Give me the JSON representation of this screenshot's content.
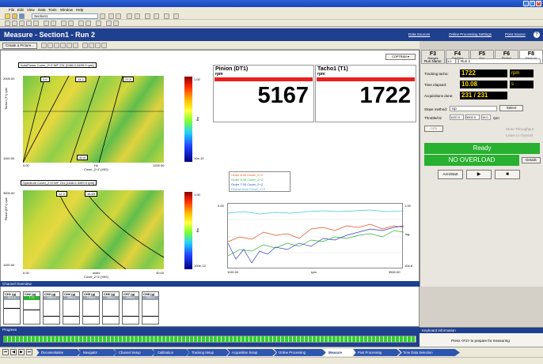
{
  "menu": [
    "File",
    "Edit",
    "View",
    "Data",
    "Tools",
    "Window",
    "Help"
  ],
  "toolbar": {
    "project_value": "Section1"
  },
  "header": {
    "title": "Measure  -  Section1  -  Run 2",
    "link_data_sources": "Data Sources",
    "link_online_settings": "Online Processing Settings",
    "link_point_source": "Point Source"
  },
  "subbar": {
    "create_picture": "Create a Picture..."
  },
  "plots": {
    "top_label": "AutoPower Cover_2+Z:WF 231 [1166.0-3499.9 rpm]",
    "top_y_ticks": [
      "2000.00",
      "1100.00"
    ],
    "top_y_axis": "Tacho1 (T1)\nrpm",
    "top_x_ticks": [
      "0.00",
      "1200.00"
    ],
    "top_x_axis": "Hz\nCover_2+Z (X92)",
    "top_markers": [
      "3.6",
      "14.2",
      "21.8",
      "40.8"
    ],
    "top_cbar_ticks": [
      "1.00",
      "log",
      "10e-12"
    ],
    "bottom_label": "Spectrum Cover_2+Z:WF 231 [1166.0-3499.9 rpm]",
    "bottom_y_ticks": [
      "3500.00",
      "1100.00"
    ],
    "bottom_y_axis": "Pinion (DT1)\nrpm",
    "bottom_x_ticks": [
      "0.00",
      "40.00"
    ],
    "bottom_x_axis": "order\nCover_2+Z (X92)",
    "bottom_markers": [
      "12.3",
      "16.65"
    ],
    "bottom_cbar_ticks": [
      "1.00",
      "log",
      "100e-12"
    ]
  },
  "meters": [
    {
      "name": "Pinion (DT1)",
      "unit": "rpm",
      "value": "5167"
    },
    {
      "name": "Tacho1 (T1)",
      "unit": "rpm",
      "value": "1722"
    }
  ],
  "order_chart": {
    "legend": [
      "Order 8.00 Cover_2+Z",
      "Order 9.00 Cover_2+Z",
      "Order 7.00 Cover_2+Z",
      "Overall level Cover_2+Z"
    ],
    "x_ticks": [
      "1100.00",
      "rpm",
      "3500.00"
    ],
    "y_ticks_left": [
      "0.00",
      "",
      "",
      ""
    ],
    "y_ticks_right": [
      "1.00",
      "log",
      "10e-6"
    ],
    "y_axis_right": "g2",
    "legend_colors": [
      "#e05020",
      "#30b030",
      "#3040c0",
      "#40c8d8"
    ]
  },
  "right": {
    "fkeys": [
      {
        "key": "F3",
        "label": "Ranges"
      },
      {
        "key": "F4",
        "label": "Tracking"
      },
      {
        "key": "F5",
        "label": "Acq."
      },
      {
        "key": "F6",
        "label": "Project"
      },
      {
        "key": "F8",
        "label": "Measure"
      }
    ],
    "run_name_label": "Run Name",
    "run_name_prefix": "1/1",
    "run_name_value": "Run 2",
    "tracking_label": "Tracking tacho:",
    "tracking_value": "1722",
    "tracking_unit": "rpm",
    "time_label": "Time elapsed:",
    "time_value": "10.08",
    "time_unit": "s",
    "acq_label": "Acquisitions done:",
    "acq_value": "231 / 231",
    "slope_label": "Slope method:",
    "slope_value": "Up",
    "select_btn": "Select",
    "freq_label": "Throttle/Hz",
    "freq_vals": [
      "1100.0",
      "3500.0",
      "16.0"
    ],
    "freq_unit": "rpm",
    "arm_btn": "Arm",
    "store_throughput": "Store Throughput",
    "listen_channel": "Listen to channel",
    "status_ready": "Ready",
    "status_overload": "NO OVERLOAD",
    "details_btn": "Details",
    "arm_start_btn": "Arm/Start"
  },
  "channel": {
    "title": "Channel Overview",
    "items": [
      {
        "name": "CH1 (g)",
        "val": "50.0 E"
      },
      {
        "name": "CH2 (g)",
        "val": "1.73"
      },
      {
        "name": "CH3 (g)",
        "val": "9999.5"
      },
      {
        "name": "CH4 (g)",
        "val": "9999.5"
      },
      {
        "name": "CH5 (g)",
        "val": "9999.5"
      },
      {
        "name": "CH6 (g)",
        "val": "9999.5"
      },
      {
        "name": "CH7 (g)",
        "val": "9999.5"
      },
      {
        "name": "CH8 (g)",
        "val": "9999.5"
      }
    ]
  },
  "progress": {
    "title": "Progress"
  },
  "keyboard": {
    "title": "Keyboard information",
    "msg": "Press <F2> to prepare for measuring"
  },
  "nav": {
    "crumbs": [
      "Documentation",
      "Navigator",
      "Channel Setup",
      "Calibration",
      "Tracking Setup",
      "Acquisition Setup",
      "Online Processing",
      "Measure",
      "Post Processing",
      "Time Data Selection"
    ],
    "active": 7
  }
}
